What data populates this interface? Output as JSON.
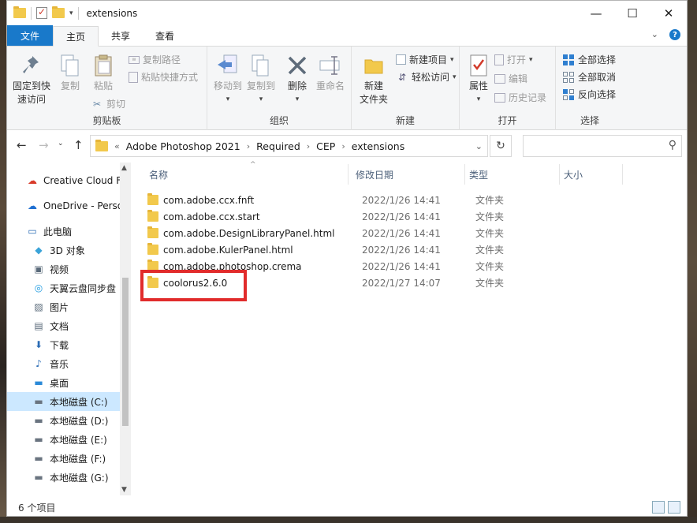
{
  "window": {
    "title": "extensions",
    "controls": [
      "—",
      "☐",
      "✕"
    ]
  },
  "ribbon_tabs": {
    "file": "文件",
    "home": "主页",
    "share": "共享",
    "view": "查看"
  },
  "clipboard": {
    "label": "剪贴板",
    "pin": "固定到快\n速访问",
    "pin_line1": "固定到快",
    "pin_line2": "速访问",
    "copy": "复制",
    "paste": "粘贴",
    "copy_path": "复制路径",
    "paste_shortcut": "粘贴快捷方式",
    "cut": "剪切"
  },
  "organize": {
    "label": "组织",
    "move_to": "移动到",
    "copy_to": "复制到",
    "delete": "删除",
    "rename": "重命名"
  },
  "new_group": {
    "label": "新建",
    "new_folder_line1": "新建",
    "new_folder_line2": "文件夹",
    "new_item": "新建项目",
    "easy_access": "轻松访问"
  },
  "open_group": {
    "label": "打开",
    "properties": "属性",
    "open": "打开",
    "edit": "编辑",
    "history": "历史记录"
  },
  "select_group": {
    "label": "选择",
    "select_all": "全部选择",
    "select_none": "全部取消",
    "invert": "反向选择"
  },
  "address": {
    "overflow": "«",
    "crumbs": [
      "Adobe Photoshop 2021",
      "Required",
      "CEP",
      "extensions"
    ],
    "search_placeholder": ""
  },
  "nav_pane": {
    "items": [
      {
        "label": "Creative Cloud Fi",
        "icon": "creative-cloud-icon"
      },
      {
        "label": "OneDrive - Perso",
        "icon": "onedrive-icon"
      },
      {
        "label": "此电脑",
        "icon": "computer-icon"
      },
      {
        "label": "3D 对象",
        "icon": "3d-objects-icon"
      },
      {
        "label": "视频",
        "icon": "video-icon"
      },
      {
        "label": "天翼云盘同步盘",
        "icon": "cloud-sync-icon"
      },
      {
        "label": "图片",
        "icon": "pictures-icon"
      },
      {
        "label": "文档",
        "icon": "documents-icon"
      },
      {
        "label": "下载",
        "icon": "download-icon"
      },
      {
        "label": "音乐",
        "icon": "music-icon"
      },
      {
        "label": "桌面",
        "icon": "desktop-icon"
      },
      {
        "label": "本地磁盘 (C:)",
        "icon": "drive-icon"
      },
      {
        "label": "本地磁盘 (D:)",
        "icon": "drive-icon"
      },
      {
        "label": "本地磁盘 (E:)",
        "icon": "drive-icon"
      },
      {
        "label": "本地磁盘 (F:)",
        "icon": "drive-icon"
      },
      {
        "label": "本地磁盘 (G:)",
        "icon": "drive-icon"
      }
    ]
  },
  "columns": {
    "name": "名称",
    "date": "修改日期",
    "type": "类型",
    "size": "大小"
  },
  "files": [
    {
      "name": "com.adobe.ccx.fnft",
      "date": "2022/1/26 14:41",
      "type": "文件夹"
    },
    {
      "name": "com.adobe.ccx.start",
      "date": "2022/1/26 14:41",
      "type": "文件夹"
    },
    {
      "name": "com.adobe.DesignLibraryPanel.html",
      "date": "2022/1/26 14:41",
      "type": "文件夹"
    },
    {
      "name": "com.adobe.KulerPanel.html",
      "date": "2022/1/26 14:41",
      "type": "文件夹"
    },
    {
      "name": "com.adobe.photoshop.crema",
      "date": "2022/1/26 14:41",
      "type": "文件夹"
    },
    {
      "name": "coolorus2.6.0",
      "date": "2022/1/27 14:07",
      "type": "文件夹"
    }
  ],
  "status": {
    "count": "6 个项目"
  },
  "colors": {
    "file_tab": "#1979ca",
    "highlight_box": "#e12b2b",
    "selection": "#cce8ff",
    "folder": "#f2c94c"
  }
}
